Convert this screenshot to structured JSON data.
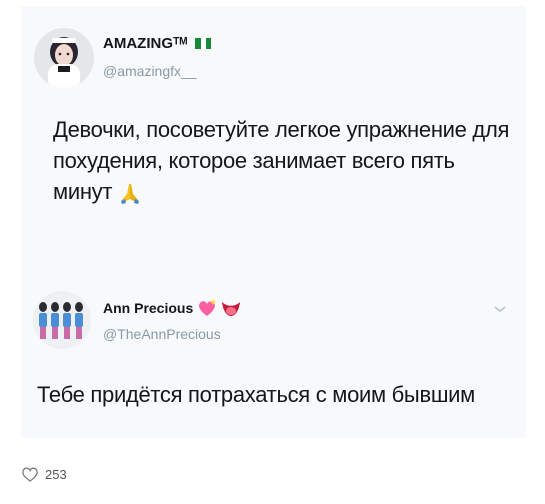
{
  "tweet1": {
    "display_name": "AMAZINGᵀᴹ",
    "flag_colors": [
      "#1a8a3a",
      "#ffffff",
      "#1a8a3a"
    ],
    "handle": "@amazingfx__",
    "text": "Девочки, посоветуйте легкое упражнение для похудения, которое занимает всего пять минут",
    "trailing_icon": "praying-hands-icon"
  },
  "tweet2": {
    "display_name": "Ann Precious",
    "name_icons": [
      "sparkling-heart-icon",
      "tongue-face-icon"
    ],
    "handle": "@TheAnnPrecious",
    "text": "Тебе придётся потрахаться с моим бывшим",
    "menu_icon": "chevron-down-icon"
  },
  "footer": {
    "like_icon": "heart-outline-icon",
    "like_count": "253"
  },
  "colors": {
    "card_bg": "#f7f9fb",
    "handle_gray": "#8a99a6",
    "text": "#14171a"
  }
}
